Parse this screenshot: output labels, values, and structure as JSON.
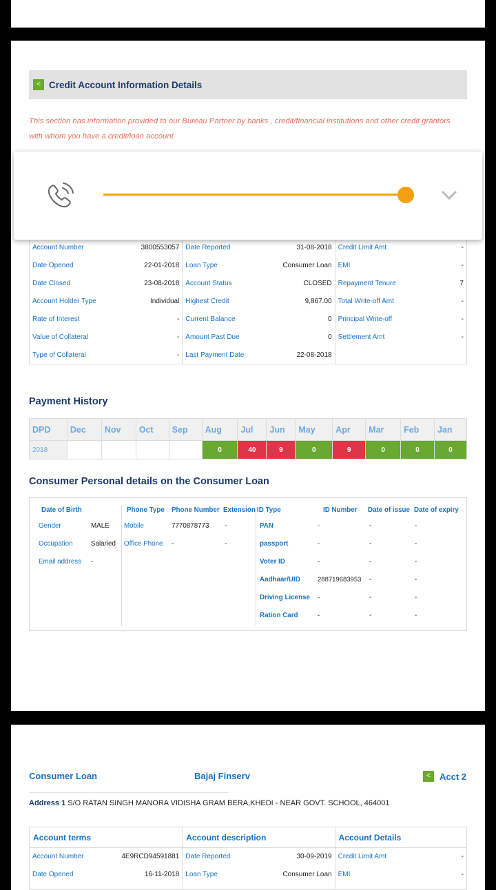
{
  "section": {
    "back_label": "<",
    "title": "Credit Account Information Details",
    "intro": "This section has information provided to our Bureau Partner by banks , credit/financial institutions and other credit grantors with whom you have a credit/loan account"
  },
  "player": {
    "icon": "phone-ringing-icon",
    "progress": 1.0,
    "accent_color": "#F4A012",
    "expand_icon": "chevron-down-icon"
  },
  "account1": {
    "col1": [
      {
        "label": "Account Number",
        "value": "3800553057"
      },
      {
        "label": "Date Opened",
        "value": "22-01-2018"
      },
      {
        "label": "Date Closed",
        "value": "23-08-2018"
      },
      {
        "label": "Account Holder Type",
        "value": "Individual"
      },
      {
        "label": "Rate of Interest",
        "value": "-"
      },
      {
        "label": "Value of Collateral",
        "value": "-"
      },
      {
        "label": "Type of Collateral",
        "value": "-"
      }
    ],
    "col2": [
      {
        "label": "Date Reported",
        "value": "31-08-2018"
      },
      {
        "label": "Loan Type",
        "value": "Consumer Loan"
      },
      {
        "label": "Account Status",
        "value": "CLOSED"
      },
      {
        "label": "Highest Credit",
        "value": "9,867.00"
      },
      {
        "label": "Current Balance",
        "value": "0"
      },
      {
        "label": "Amount Past Due",
        "value": "0"
      },
      {
        "label": "Last Payment Date",
        "value": "22-08-2018"
      }
    ],
    "col3": [
      {
        "label": "Credit Limit Amt",
        "value": "-"
      },
      {
        "label": "EMI",
        "value": "-"
      },
      {
        "label": "Repayment Tenure",
        "value": "7"
      },
      {
        "label": "Total Write-off Amt",
        "value": "-"
      },
      {
        "label": "Principal Write-off",
        "value": "-"
      },
      {
        "label": "Settlement Amt",
        "value": "-"
      }
    ]
  },
  "payment_history": {
    "title": "Payment History",
    "headers": [
      "DPD",
      "Dec",
      "Nov",
      "Oct",
      "Sep",
      "Aug",
      "Jul",
      "Jun",
      "May",
      "Apr",
      "Mar",
      "Feb",
      "Jan"
    ],
    "year": "2018",
    "cells": [
      "",
      "",
      "",
      "",
      "0",
      "40",
      "9",
      "0",
      "9",
      "0",
      "0",
      "0"
    ],
    "status": [
      "empty",
      "empty",
      "empty",
      "empty",
      "ok",
      "late",
      "late",
      "ok",
      "late",
      "ok",
      "ok",
      "ok"
    ],
    "colors": {
      "ok": "#69A831",
      "late": "#E03448"
    }
  },
  "personal": {
    "title": "Consumer Personal details on the Consumer Loan",
    "dob_header": "Date of Birth",
    "fields": [
      {
        "label": "Gender",
        "value": "MALE"
      },
      {
        "label": "Occupation",
        "value": "Salaried"
      },
      {
        "label": "Email address",
        "value": "-"
      }
    ],
    "phone_headers": [
      "Phone Type",
      "Phone Number",
      "Extension"
    ],
    "phones": [
      {
        "type": "Mobile",
        "number": "7770878773",
        "ext": "-"
      },
      {
        "type": "Office Phone",
        "number": "-",
        "ext": "-"
      }
    ],
    "id_headers": [
      "ID Type",
      "ID Number",
      "Date of issue",
      "Date of expiry"
    ],
    "ids": [
      {
        "type": "PAN",
        "number": "-",
        "issue": "-",
        "expiry": "-"
      },
      {
        "type": "passport",
        "number": "-",
        "issue": "-",
        "expiry": "-"
      },
      {
        "type": "Voter ID",
        "number": "-",
        "issue": "-",
        "expiry": "-"
      },
      {
        "type": "Aadhaar/UID",
        "number": "288719683953",
        "issue": "-",
        "expiry": "-"
      },
      {
        "type": "Driving License",
        "number": "-",
        "issue": "-",
        "expiry": "-"
      },
      {
        "type": "Ration Card",
        "number": "-",
        "issue": "-",
        "expiry": "-"
      }
    ]
  },
  "account2": {
    "loan_type": "Consumer Loan",
    "lender": "Bajaj Finserv",
    "back_label": "<",
    "acct_label": "Acct 2",
    "address_label": "Address 1",
    "address": "S/O RATAN SINGH MANORA VIDISHA GRAM BERA,KHEDI - NEAR GOVT. SCHOOL, 464001",
    "col_headers": [
      "Account terms",
      "Account description",
      "Account Details"
    ],
    "col1": [
      {
        "label": "Account Number",
        "value": "4E9RCD94591881"
      },
      {
        "label": "Date Opened",
        "value": "16-11-2018"
      }
    ],
    "col2": [
      {
        "label": "Date Reported",
        "value": "30-09-2019"
      },
      {
        "label": "Loan Type",
        "value": "Consumer Loan"
      }
    ],
    "col3": [
      {
        "label": "Credit Limit Amt",
        "value": "-"
      },
      {
        "label": "EMI",
        "value": "-"
      }
    ]
  }
}
